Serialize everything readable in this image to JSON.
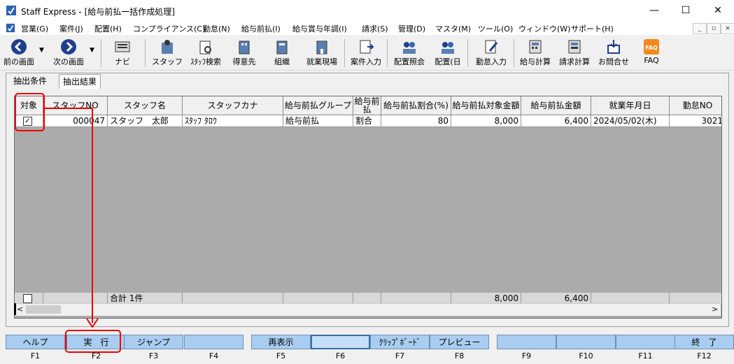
{
  "window": {
    "title": "Staff Express - [給与前払一括作成処理]",
    "minimize": "—",
    "maximize": "☐",
    "close": "✕"
  },
  "menu": [
    "営業(G)",
    "案件(J)",
    "配置(H)",
    "コンプライアンス(C)",
    "勤怠(N)",
    "給与前払(I)",
    "給与賞与年調(I)",
    "請求(S)",
    "管理(D)",
    "マスタ(M)",
    "ツール(O)",
    "ウィンドウ(W)",
    "サポート(H)"
  ],
  "mdi_controls": [
    "_",
    "▫",
    "×"
  ],
  "toolbar": {
    "prev": "前の画面",
    "next": "次の画面",
    "navi": "ナビ",
    "staff": "スタッフ",
    "staff_search": "ｽﾀｯﾌ検索",
    "client": "得意先",
    "org": "組織",
    "site": "就業現場",
    "case_input": "案件入力",
    "assign_inquiry": "配置照会",
    "assign_day": "配置(日",
    "attendance_input": "勤怠入力",
    "payroll_calc": "給与計算",
    "billing_calc": "請求計算",
    "contact": "お問合せ",
    "faq": "FAQ",
    "faq_icon_text": "FAQ"
  },
  "tabs": {
    "conditions": "抽出条件",
    "results": "抽出結果"
  },
  "grid": {
    "headers": {
      "target": "対象",
      "staff_no": "スタッフNO",
      "staff_name": "スタッフ名",
      "staff_kana": "スタッフカナ",
      "group": "給与前払グループ",
      "prepay": "給与前払",
      "rate": "給与前払割合(%)",
      "target_amount": "給与前払対象金額",
      "amount": "給与前払金額",
      "work_date": "就業年月日",
      "attendance_no": "勤怠NO"
    },
    "row": {
      "checked": "✓",
      "staff_no": "000047",
      "staff_name": "スタッフ　太郎",
      "staff_kana": "ｽﾀｯﾌ ﾀﾛｳ",
      "group": "給与前払",
      "prepay": "割合",
      "rate": "80",
      "target_amount": "8,000",
      "amount": "6,400",
      "work_date": "2024/05/02(木)",
      "attendance_no": "3021"
    },
    "footer": {
      "total": "合計 1件",
      "target_amount": "8,000",
      "amount": "6,400"
    }
  },
  "scroll": {
    "left": "<",
    "right": ">"
  },
  "fkeys": [
    {
      "label": "ヘルプ",
      "key": "F1"
    },
    {
      "label": "実　行",
      "key": "F2"
    },
    {
      "label": "ジャンプ",
      "key": "F3"
    },
    {
      "label": "",
      "key": "F4"
    },
    {
      "label": "再表示",
      "key": "F5"
    },
    {
      "label": "",
      "key": "F6"
    },
    {
      "label": "ｸﾘｯﾌﾟﾎﾞｰﾄﾞ",
      "key": "F7"
    },
    {
      "label": "プレビュー",
      "key": "F8"
    },
    {
      "label": "",
      "key": "F9"
    },
    {
      "label": "",
      "key": "F10"
    },
    {
      "label": "",
      "key": "F11"
    },
    {
      "label": "終　了",
      "key": "F12"
    }
  ],
  "colors": {
    "fkey": "#a8cdf0",
    "highlight": "#e00000",
    "grid_bg": "#ababab"
  }
}
